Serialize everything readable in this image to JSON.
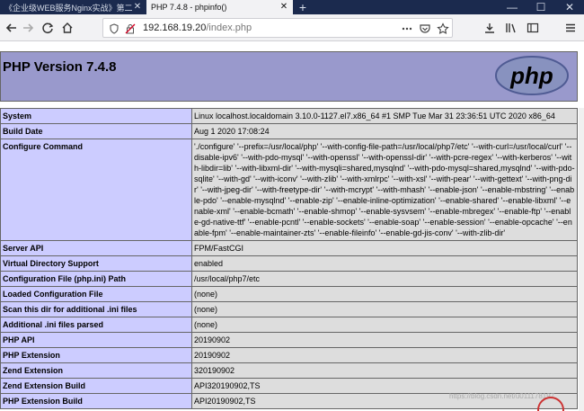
{
  "browser": {
    "tabs": [
      {
        "title": "《企业级WEB服务Nginx实战》第二",
        "active": false
      },
      {
        "title": "PHP 7.4.8 - phpinfo()",
        "active": true
      }
    ],
    "new_tab_icon": "+",
    "window_controls": [
      "—",
      "☐",
      "✕"
    ],
    "url": {
      "host": "192.168.19.20",
      "path": "/index.php"
    }
  },
  "page": {
    "title": "PHP Version 7.4.8",
    "logo_text": "php",
    "rows": [
      {
        "key": "System",
        "value": "Linux localhost.localdomain 3.10.0-1127.el7.x86_64 #1 SMP Tue Mar 31 23:36:51 UTC 2020 x86_64"
      },
      {
        "key": "Build Date",
        "value": "Aug 1 2020 17:08:24"
      },
      {
        "key": "Configure Command",
        "value": "'./configure' '--prefix=/usr/local/php' '--with-config-file-path=/usr/local/php7/etc' '--with-curl=/usr/local/curl' '--disable-ipv6' '--with-pdo-mysql' '--with-openssl' '--with-openssl-dir' '--with-pcre-regex' '--with-kerberos' '--with-libdir=lib' '--with-libxml-dir' '--with-mysqli=shared,mysqlnd' '--with-pdo-mysql=shared,mysqlnd' '--with-pdo-sqlite' '--with-gd' '--with-iconv' '--with-zlib' '--with-xmlrpc' '--with-xsl' '--with-pear' '--with-gettext' '--with-png-dir' '--with-jpeg-dir' '--with-freetype-dir' '--with-mcrypt' '--with-mhash' '--enable-json' '--enable-mbstring' '--enable-pdo' '--enable-mysqlnd' '--enable-zip' '--enable-inline-optimization' '--enable-shared' '--enable-libxml' '--enable-xml' '--enable-bcmath' '--enable-shmop' '--enable-sysvsem' '--enable-mbregex' '--enable-ftp' '--enable-gd-native-ttf' '--enable-pcntl' '--enable-sockets' '--enable-soap' '--enable-session' '--enable-opcache' '--enable-fpm' '--enable-maintainer-zts' '--enable-fileinfo' '--enable-gd-jis-conv' '--with-zlib-dir'"
      },
      {
        "key": "Server API",
        "value": "FPM/FastCGI"
      },
      {
        "key": "Virtual Directory Support",
        "value": "enabled"
      },
      {
        "key": "Configuration File (php.ini) Path",
        "value": "/usr/local/php7/etc"
      },
      {
        "key": "Loaded Configuration File",
        "value": "(none)"
      },
      {
        "key": "Scan this dir for additional .ini files",
        "value": "(none)"
      },
      {
        "key": "Additional .ini files parsed",
        "value": "(none)"
      },
      {
        "key": "PHP API",
        "value": "20190902"
      },
      {
        "key": "PHP Extension",
        "value": "20190902"
      },
      {
        "key": "Zend Extension",
        "value": "320190902"
      },
      {
        "key": "Zend Extension Build",
        "value": "API320190902,TS"
      },
      {
        "key": "PHP Extension Build",
        "value": "API20190902,TS"
      }
    ],
    "watermark": "https://blog.csdn.net/u011178197"
  },
  "colors": {
    "header_bg": "#9999cc",
    "key_bg": "#ccccff",
    "value_bg": "#dddddd",
    "tabstrip_bg": "#1b2a4e"
  }
}
